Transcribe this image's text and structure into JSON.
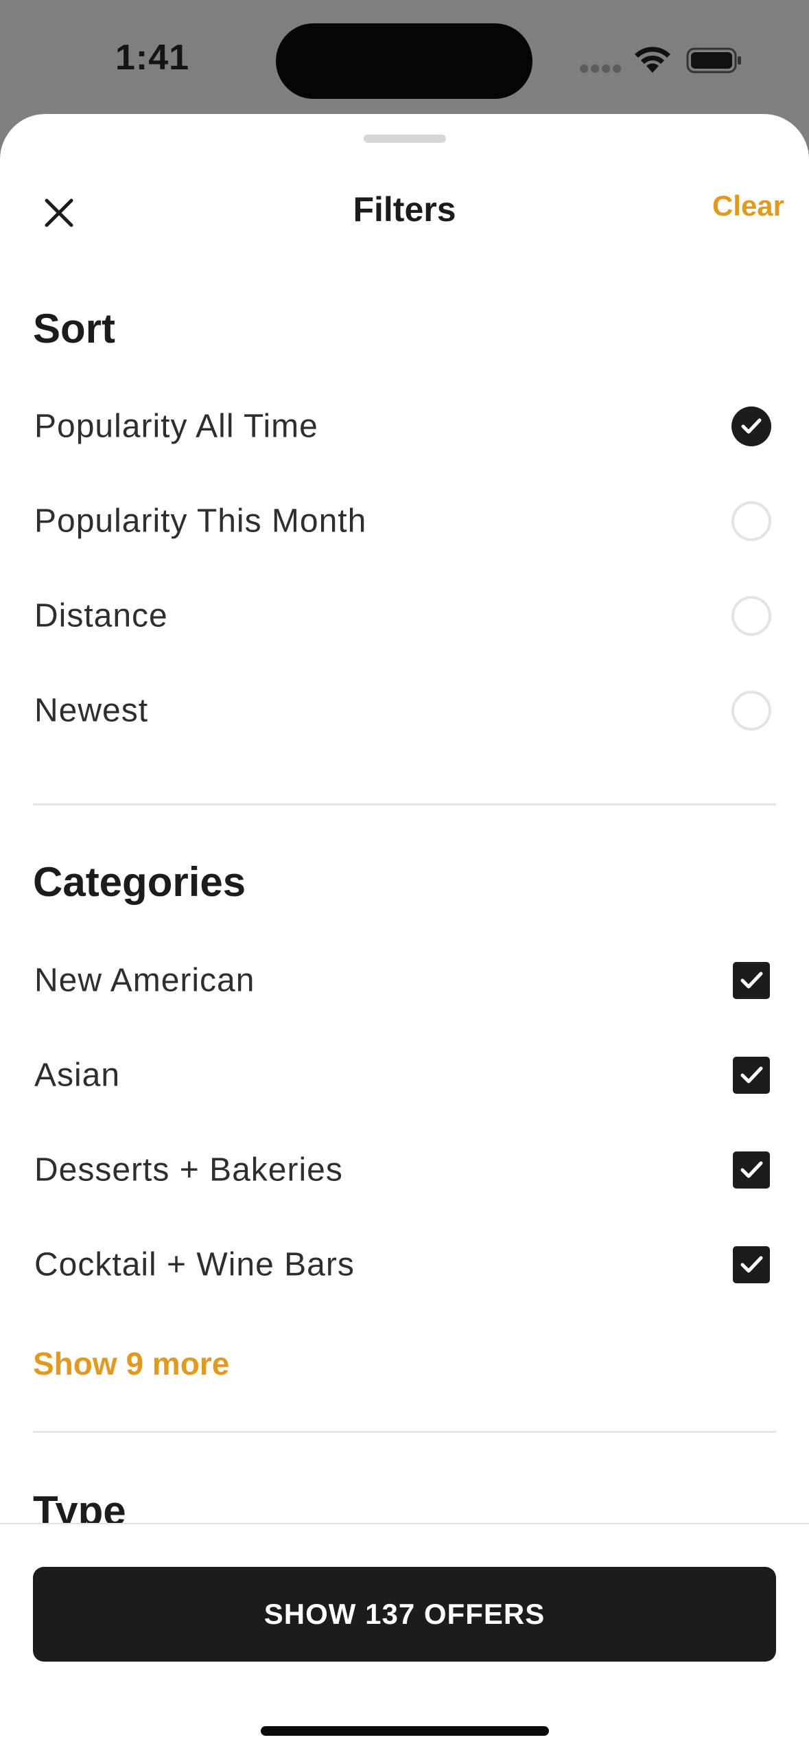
{
  "status_bar": {
    "time": "1:41",
    "icons": [
      "cellular-signal-icon",
      "wifi-icon",
      "battery-icon"
    ]
  },
  "header": {
    "title": "Filters",
    "clear_label": "Clear",
    "close_icon": "close-icon"
  },
  "sort": {
    "title": "Sort",
    "options": [
      {
        "label": "Popularity All Time",
        "selected": true
      },
      {
        "label": "Popularity This Month",
        "selected": false
      },
      {
        "label": "Distance",
        "selected": false
      },
      {
        "label": "Newest",
        "selected": false
      }
    ]
  },
  "categories": {
    "title": "Categories",
    "items": [
      {
        "label": "New American",
        "checked": true
      },
      {
        "label": "Asian",
        "checked": true
      },
      {
        "label": "Desserts + Bakeries",
        "checked": true
      },
      {
        "label": "Cocktail + Wine Bars",
        "checked": true
      }
    ],
    "show_more_label": "Show 9 more"
  },
  "type": {
    "title": "Type"
  },
  "footer": {
    "cta_label": "SHOW 137 OFFERS"
  },
  "colors": {
    "accent": "#e19a1f",
    "dark": "#1c1c1c",
    "backdrop": "#7f7f7f"
  }
}
